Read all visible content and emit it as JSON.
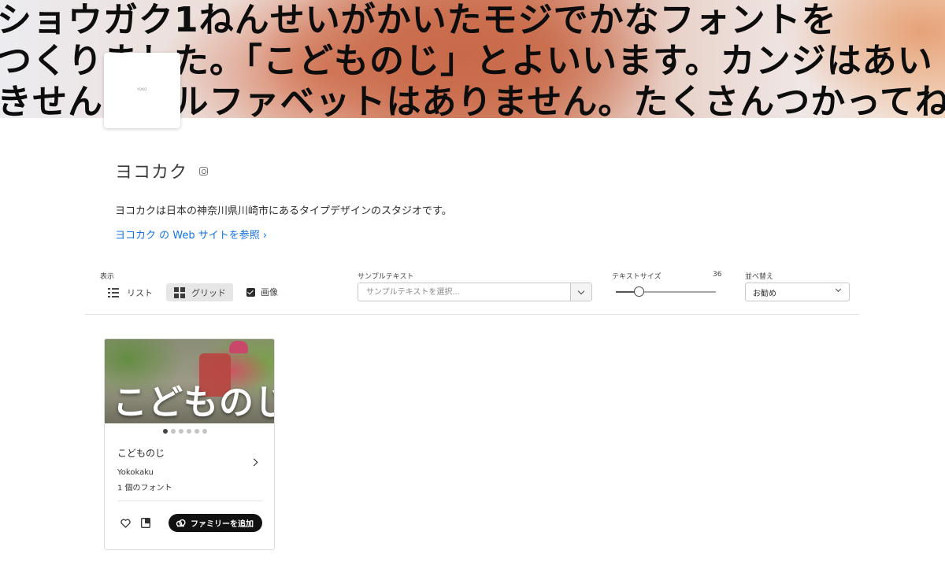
{
  "hero": {
    "line1": "ショウガク1ねんせいがかいたモジでかなフォントを",
    "line2": "つくりました。「こどものじ」とよいいます。カンジはあい",
    "line3": "きせん。アルファベットはありません。たくさんつかってね。"
  },
  "foundry": {
    "logo_text": "YOKO",
    "name": "ヨコカク",
    "description": "ヨコカクは日本の神奈川県川崎市にあるタイプデザインのスタジオです。",
    "website_link": "ヨコカク の Web サイトを参照 ›"
  },
  "toolbar": {
    "view_label": "表示",
    "list_label": "リスト",
    "grid_label": "グリッド",
    "image_label": "画像",
    "image_checked": true,
    "sample_label": "サンプルテキスト",
    "sample_placeholder": "サンプルテキストを選択...",
    "size_label": "テキストサイズ",
    "size_value": "36",
    "size_fraction": 0.23,
    "sort_label": "並べ替え",
    "sort_value": "お勧め"
  },
  "card": {
    "image_text": "こどものじ",
    "family_name": "こどものじ",
    "foundry": "Yokokaku",
    "font_count": "1 個のフォント",
    "add_button": "ファミリーを追加",
    "dots_total": 6,
    "dots_active": 0
  }
}
